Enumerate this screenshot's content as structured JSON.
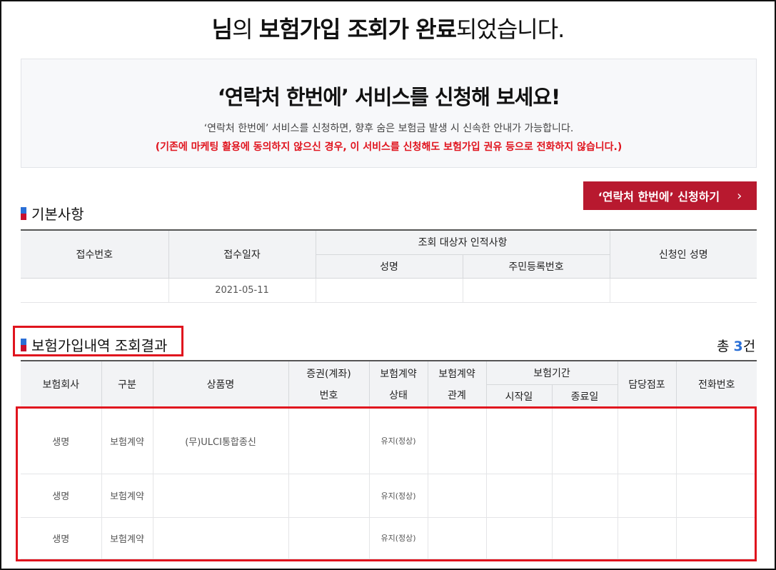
{
  "headline": {
    "part1": "님",
    "part2": "의 ",
    "part3": "보험가입 조회가 완료",
    "part4": "되었습니다."
  },
  "promo": {
    "title": "‘연락처 한번에’ 서비스를 신청해 보세요!",
    "description": "‘연락처 한번에’ 서비스를 신청하면, 향후 숨은 보험금 발생 시 신속한 안내가 가능합니다.",
    "warning": "(기존에 마케팅 활용에 동의하지 않으신 경우, 이 서비스를 신청해도 보험가입 권유 등으로 전화하지 않습니다.)",
    "button_label": "‘연락처 한번에’ 신청하기",
    "button_chevron": "›"
  },
  "basic": {
    "title": "기본사항",
    "headers": {
      "receipt_no": "접수번호",
      "receipt_date": "접수일자",
      "subject_group": "조회 대상자 인적사항",
      "name": "성명",
      "rrn": "주민등록번호",
      "applicant": "신청인 성명"
    },
    "row": {
      "receipt_no": "",
      "receipt_date": "2021-05-11",
      "name": "",
      "rrn": "",
      "applicant": ""
    }
  },
  "results": {
    "title": "보험가입내역 조회결과",
    "count_prefix": "총 ",
    "count": "3",
    "count_suffix": "건",
    "headers": {
      "company": "보험회사",
      "type": "구분",
      "product": "상품명",
      "cert_l1": "증권(계좌)",
      "cert_l2": "번호",
      "status_l1": "보험계약",
      "status_l2": "상태",
      "relation_l1": "보험계약",
      "relation_l2": "관계",
      "period": "보험기간",
      "start": "시작일",
      "end": "종료일",
      "branch": "담당점포",
      "phone": "전화번호"
    },
    "rows": [
      {
        "company": "생명",
        "type": "보험계약",
        "product": "(무)ULCI통합종신",
        "cert": "",
        "status": "유지(정상)",
        "relation": "",
        "start": "",
        "end": "",
        "branch": "",
        "phone": ""
      },
      {
        "company": "생명",
        "type": "보험계약",
        "product": "",
        "cert": "",
        "status": "유지(정상)",
        "relation": "",
        "start": "",
        "end": "",
        "branch": "",
        "phone": ""
      },
      {
        "company": "생명",
        "type": "보험계약",
        "product": "",
        "cert": "",
        "status": "유지(정상)",
        "relation": "",
        "start": "",
        "end": "",
        "branch": "",
        "phone": ""
      }
    ]
  },
  "colors": {
    "accent_red": "#b8192f",
    "warning_red": "#e0141e",
    "highlight_blue": "#2a6fd6"
  }
}
